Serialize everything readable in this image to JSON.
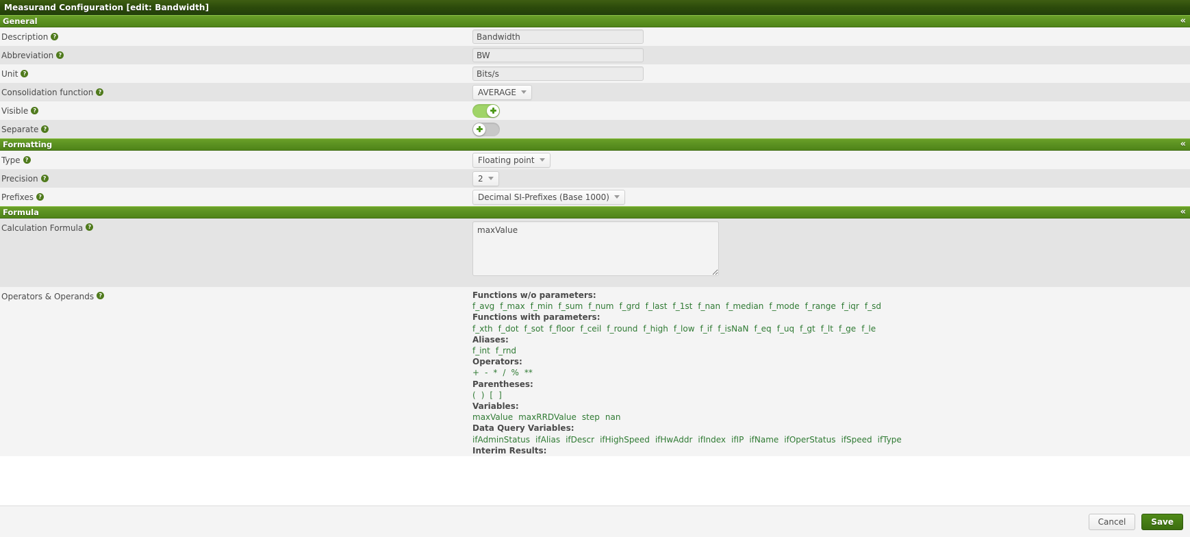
{
  "window": {
    "title": "Measurand Configuration [edit: Bandwidth]"
  },
  "sections": {
    "general": {
      "title": "General",
      "collapse_icon": "chevron-double-up"
    },
    "formatting": {
      "title": "Formatting",
      "collapse_icon": "chevron-double-up"
    },
    "formula": {
      "title": "Formula",
      "collapse_icon": "chevron-double-up"
    }
  },
  "fields": {
    "description": {
      "label": "Description",
      "value": "Bandwidth",
      "placeholder": ""
    },
    "abbreviation": {
      "label": "Abbreviation",
      "value": "BW",
      "placeholder": ""
    },
    "unit": {
      "label": "Unit",
      "value": "Bits/s",
      "placeholder": ""
    },
    "consolidation_function": {
      "label": "Consolidation function",
      "value": "AVERAGE"
    },
    "visible": {
      "label": "Visible",
      "state": "on"
    },
    "separate": {
      "label": "Separate",
      "state": "off"
    },
    "type": {
      "label": "Type",
      "value": "Floating point"
    },
    "precision": {
      "label": "Precision",
      "value": "2"
    },
    "prefixes": {
      "label": "Prefixes",
      "value": "Decimal SI-Prefixes (Base 1000)"
    },
    "calculation_formula": {
      "label": "Calculation Formula",
      "value": "maxValue"
    },
    "operators_operands": {
      "label": "Operators & Operands"
    }
  },
  "operators_operands": {
    "groups": [
      {
        "heading": "Functions w/o parameters:",
        "items": [
          "f_avg",
          "f_max",
          "f_min",
          "f_sum",
          "f_num",
          "f_grd",
          "f_last",
          "f_1st",
          "f_nan",
          "f_median",
          "f_mode",
          "f_range",
          "f_iqr",
          "f_sd"
        ]
      },
      {
        "heading": "Functions with parameters:",
        "items": [
          "f_xth",
          "f_dot",
          "f_sot",
          "f_floor",
          "f_ceil",
          "f_round",
          "f_high",
          "f_low",
          "f_if",
          "f_isNaN",
          "f_eq",
          "f_uq",
          "f_gt",
          "f_lt",
          "f_ge",
          "f_le"
        ]
      },
      {
        "heading": "Aliases:",
        "items": [
          "f_int",
          "f_rnd"
        ]
      },
      {
        "heading": "Operators:",
        "items": [
          "+",
          "-",
          "*",
          "/",
          "%",
          "**"
        ]
      },
      {
        "heading": "Parentheses:",
        "items": [
          "(",
          ")",
          "[",
          "]"
        ]
      },
      {
        "heading": "Variables:",
        "items": [
          "maxValue",
          "maxRRDValue",
          "step",
          "nan"
        ]
      },
      {
        "heading": "Data Query Variables:",
        "items": [
          "ifAdminStatus",
          "ifAlias",
          "ifDescr",
          "ifHighSpeed",
          "ifHwAddr",
          "ifIndex",
          "ifIP",
          "ifName",
          "ifOperStatus",
          "ifSpeed",
          "ifType"
        ]
      },
      {
        "heading": "Interim Results:",
        "items": []
      }
    ]
  },
  "footer": {
    "cancel_label": "Cancel",
    "save_label": "Save"
  },
  "colors": {
    "titlebar_dark_green": "#2c4a0b",
    "section_green": "#5d9322",
    "toggle_on_green": "#a0d468",
    "toggle_off_gray": "#c8c8c8",
    "link_green": "#2f7a33",
    "save_button_green": "#4f8a18"
  },
  "icons": {
    "help": "?",
    "collapse": "«"
  }
}
